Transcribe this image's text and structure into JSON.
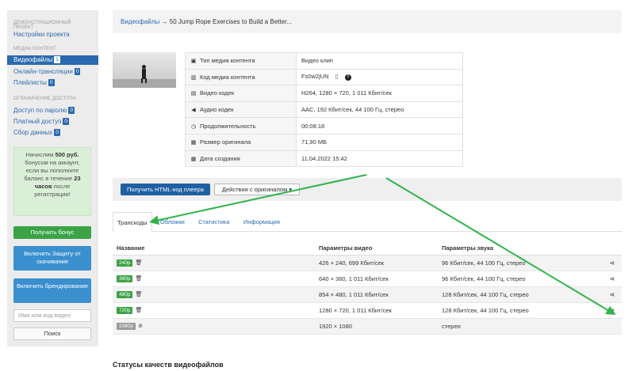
{
  "sidebar": {
    "section_project": "ДЕМОНСТРАЦИОННЫЙ ПРОЕКТ",
    "project_settings": "Настройки проекта",
    "section_content": "МЕДИА КОНТЕНТ",
    "videofiles": {
      "label": "Видеофайлы",
      "count": "1"
    },
    "live": {
      "label": "Онлайн-трансляции",
      "count": "0"
    },
    "playlists": {
      "label": "Плейлисты",
      "count": "0"
    },
    "section_access": "ОГРАНИЧЕНИЕ ДОСТУПА",
    "password_access": {
      "label": "Доступ по паролю",
      "count": "0"
    },
    "paid_access": {
      "label": "Платный доступ",
      "count": "0"
    },
    "data_collect": {
      "label": "Сбор данных",
      "count": "0"
    },
    "promo": {
      "line1": "Начислим ",
      "amount": "500 руб.",
      "line2": " бонусом на аккаунт, если вы пополните баланс в течение ",
      "hours": "23 часов",
      "line3": " после регистрации!"
    },
    "bonus_button": "Получить бонус",
    "protect_button": "Включить Защиту от скачивания",
    "branding_button": "Включить брендирование",
    "search_placeholder": "Имя или код видео",
    "search_button": "Поиск"
  },
  "breadcrumb": {
    "root": "Видеофайлы",
    "separator": " → ",
    "current": "50 Jump Rope Exercises to Build a Better..."
  },
  "media_info": [
    {
      "icon": "file-icon",
      "glyph": "▣",
      "key": "Тип медиа контента",
      "value": "Видео клип"
    },
    {
      "icon": "barcode-icon",
      "glyph": "▥",
      "key": "Код медиа контента",
      "value": "Fs0w2jUN",
      "has_copy": true,
      "has_help": true
    },
    {
      "icon": "film-icon",
      "glyph": "▤",
      "key": "Видео кодек",
      "value": "H264, 1280 × 720, 1 011 Кбит/сек"
    },
    {
      "icon": "speaker-icon",
      "glyph": "◀",
      "key": "Аудио кодек",
      "value": "AAC, 192 Кбит/сек, 44 100 Гц, стерео"
    },
    {
      "icon": "clock-icon",
      "glyph": "◷",
      "key": "Продолжительность",
      "value": "00:08:18"
    },
    {
      "icon": "disk-icon",
      "glyph": "▦",
      "key": "Размер оригинала",
      "value": "71,90 МБ"
    },
    {
      "icon": "calendar-icon",
      "glyph": "▦",
      "key": "Дата создания",
      "value": "11.04.2022 15:42"
    }
  ],
  "actions": {
    "get_html": "Получить HTML-код плеера",
    "original_actions": "Действия с оригиналом ▾"
  },
  "tabs": [
    "Транскоды",
    "Обложки",
    "Статистика",
    "Информация"
  ],
  "transcodes": {
    "headers": [
      "Название",
      "Параметры видео",
      "Параметры звука"
    ],
    "rows": [
      {
        "quality": "240p",
        "video": "426 × 240, 699 Кбит/сек",
        "audio": "96 Кбит/сек, 44 100 Гц, стерео",
        "status": "ready"
      },
      {
        "quality": "360p",
        "video": "640 × 360, 1 011 Кбит/сек",
        "audio": "96 Кбит/сек, 44 100 Гц, стерео",
        "status": "ready"
      },
      {
        "quality": "480p",
        "video": "854 × 480, 1 011 Кбит/сек",
        "audio": "128 Кбит/сек, 44 100 Гц, стерео",
        "status": "ready"
      },
      {
        "quality": "720p",
        "video": "1280 × 720, 1 011 Кбит/сек",
        "audio": "128 Кбит/сек, 44 100 Гц, стерео",
        "status": "ready"
      },
      {
        "quality": "1080p",
        "video": "1920 × 1080",
        "audio": "стерео",
        "status": "disabled"
      }
    ]
  },
  "section_title": "Статусы качеств видеофайлов",
  "colors": {
    "accent": "#2a6ab0",
    "green": "#3aa346",
    "arrow": "#2fb34a"
  }
}
